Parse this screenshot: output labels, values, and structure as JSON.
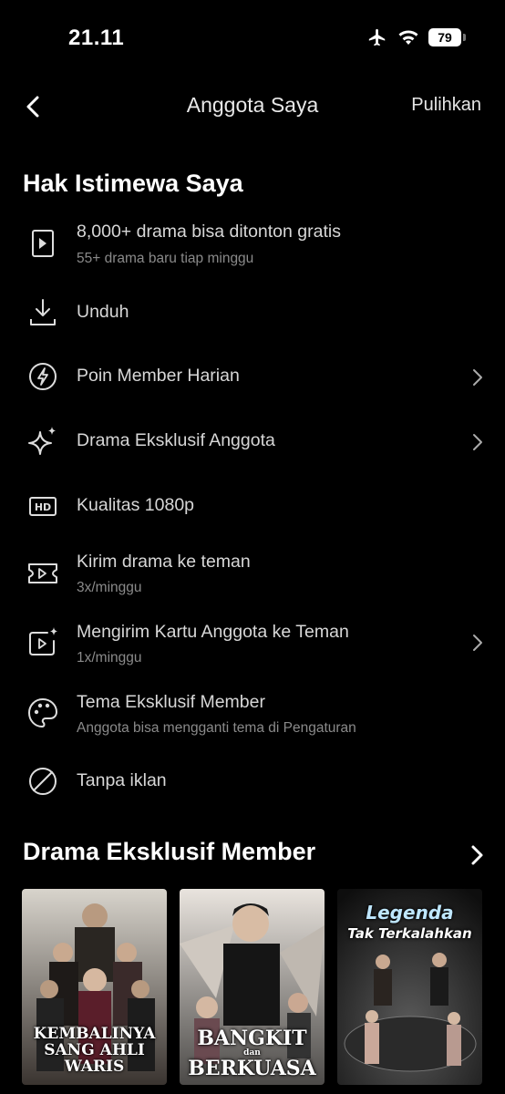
{
  "status": {
    "time": "21.11",
    "battery": "79"
  },
  "nav": {
    "title": "Anggota Saya",
    "restore": "Pulihkan"
  },
  "privileges": {
    "title": "Hak Istimewa Saya",
    "items": [
      {
        "label": "8,000+ drama bisa ditonton gratis",
        "sub": "55+ drama baru tiap minggu",
        "icon": "play-square-icon"
      },
      {
        "label": "Unduh",
        "icon": "download-icon"
      },
      {
        "label": "Poin Member Harian",
        "icon": "lightning-icon"
      },
      {
        "label": "Drama Eksklusif Anggota",
        "icon": "sparkle-icon"
      },
      {
        "label": "Kualitas 1080p",
        "icon": "hd-icon"
      },
      {
        "label": "Kirim drama ke teman",
        "sub": "3x/minggu",
        "icon": "ticket-icon"
      },
      {
        "label": "Mengirim Kartu Anggota ke Teman",
        "sub": "1x/minggu",
        "icon": "card-sparkle-icon"
      },
      {
        "label": "Tema Eksklusif Member",
        "sub": "Anggota bisa mengganti tema di Pengaturan",
        "icon": "palette-icon"
      },
      {
        "label": "Tanpa iklan",
        "icon": "no-ads-icon"
      }
    ]
  },
  "drama": {
    "title": "Drama Eksklusif Member",
    "posters": [
      {
        "line1": "KEMBALINYA",
        "line2": "SANG AHLI WARIS"
      },
      {
        "line1": "BANGKIT",
        "small": "dan",
        "line2": "BERKUASA"
      },
      {
        "line1": "Legenda",
        "line2": "Tak Terkalahkan"
      }
    ]
  }
}
